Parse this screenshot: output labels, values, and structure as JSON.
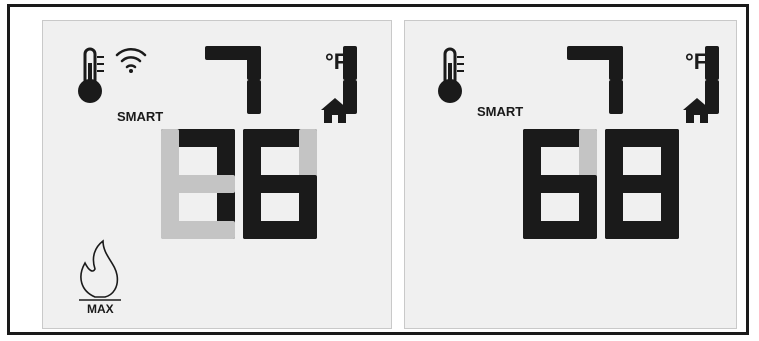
{
  "displays": [
    {
      "id": "left",
      "current_temp": "71",
      "unit": "°F",
      "set_temp": "76",
      "mode_label": "SMART",
      "wifi": true,
      "flame": true,
      "flame_label": "MAX",
      "home_icon": true
    },
    {
      "id": "right",
      "current_temp": "71",
      "unit": "°F",
      "set_temp": "68",
      "mode_label": "SMART",
      "wifi": false,
      "flame": false,
      "home_icon": true
    }
  ],
  "colors": {
    "lcd_background": "#f0f0f0",
    "segment_on": "#1a1a1a",
    "segment_ghost": "#c4c4c4"
  },
  "icons": [
    "thermometer-icon",
    "wifi-icon",
    "home-icon",
    "flame-icon"
  ]
}
